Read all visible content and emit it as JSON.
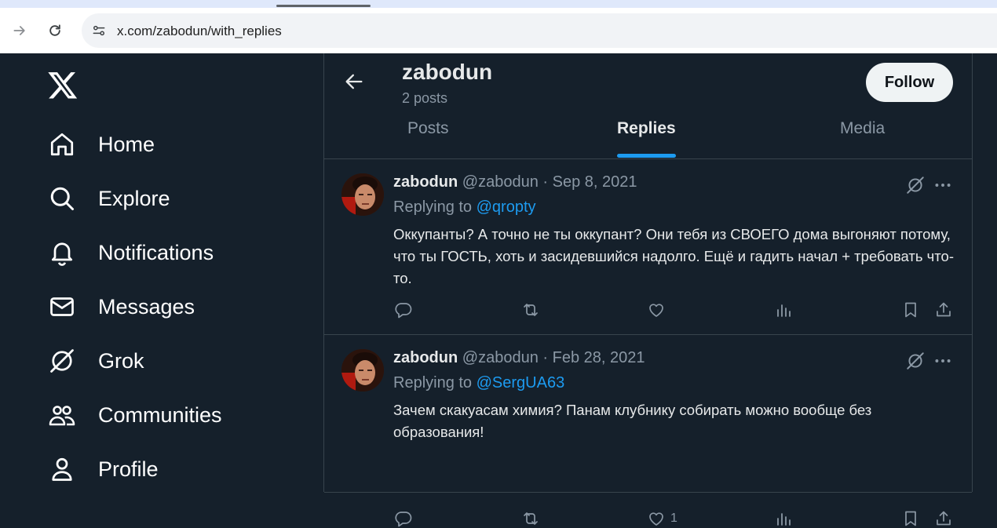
{
  "browser": {
    "url": "x.com/zabodun/with_replies",
    "icons": [
      "forward-icon",
      "reload-icon",
      "site-settings-icon"
    ]
  },
  "sidebar": {
    "logo": "x-logo",
    "items": [
      {
        "label": "Home",
        "icon": "home-icon"
      },
      {
        "label": "Explore",
        "icon": "search-icon"
      },
      {
        "label": "Notifications",
        "icon": "bell-icon"
      },
      {
        "label": "Messages",
        "icon": "envelope-icon"
      },
      {
        "label": "Grok",
        "icon": "grok-icon"
      },
      {
        "label": "Communities",
        "icon": "people-icon"
      },
      {
        "label": "Profile",
        "icon": "person-icon"
      }
    ]
  },
  "header": {
    "title": "zabodun",
    "posts_count": "2 posts",
    "follow_label": "Follow"
  },
  "tabs": [
    {
      "label": "Posts",
      "active": false
    },
    {
      "label": "Replies",
      "active": true
    },
    {
      "label": "Media",
      "active": false
    }
  ],
  "tweets": [
    {
      "name": "zabodun",
      "handle": "@zabodun",
      "separator": " · ",
      "date": "Sep 8, 2021",
      "replying_prefix": "Replying to ",
      "replying_to": "@qropty",
      "text": "Оккупанты? А точно не ты оккупант? Они тебя из СВОЕГО дома выгоняют потому, что ты ГОСТЬ, хоть и засидевшийся надолго. Ещё и гадить начал + требовать что-то.",
      "like_count": ""
    },
    {
      "name": "zabodun",
      "handle": "@zabodun",
      "separator": " · ",
      "date": "Feb 28, 2021",
      "replying_prefix": "Replying to ",
      "replying_to": "@SergUA63",
      "text": "Зачем скакуасам химия? Панам клубнику собирать можно вообще без образования!",
      "like_count": "1"
    }
  ],
  "colors": {
    "background": "#15202b",
    "accent": "#1d9bf0",
    "text_primary": "#e7e9ea",
    "text_secondary": "#8b98a5",
    "border": "#38444d"
  }
}
